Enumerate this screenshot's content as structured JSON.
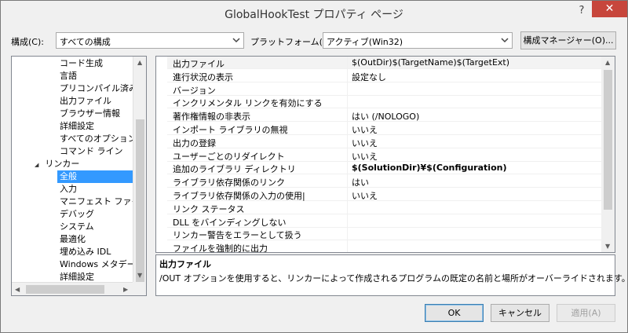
{
  "window": {
    "title": "GlobalHookTest プロパティ ページ",
    "help_glyph": "?",
    "close_glyph": "✕"
  },
  "toolbar": {
    "config_label": "構成(C):",
    "config_value": "すべての構成",
    "platform_label": "プラットフォーム(P):",
    "platform_value": "アクティブ(Win32)",
    "config_manager_button": "構成マネージャー(O)..."
  },
  "tree": {
    "items": [
      {
        "label": "コード生成",
        "level": 2
      },
      {
        "label": "言語",
        "level": 2
      },
      {
        "label": "プリコンパイル済みヘッ",
        "level": 2
      },
      {
        "label": "出力ファイル",
        "level": 2
      },
      {
        "label": "ブラウザー情報",
        "level": 2
      },
      {
        "label": "詳細設定",
        "level": 2
      },
      {
        "label": "すべてのオプション",
        "level": 2
      },
      {
        "label": "コマンド ライン",
        "level": 2
      },
      {
        "label": "リンカー",
        "level": 1,
        "expanded": true,
        "glyph": "◢"
      },
      {
        "label": "全般",
        "level": 2,
        "selected": true
      },
      {
        "label": "入力",
        "level": 2
      },
      {
        "label": "マニフェスト ファイル",
        "level": 2
      },
      {
        "label": "デバッグ",
        "level": 2
      },
      {
        "label": "システム",
        "level": 2
      },
      {
        "label": "最適化",
        "level": 2
      },
      {
        "label": "埋め込み IDL",
        "level": 2
      },
      {
        "label": "Windows メタデータ",
        "level": 2
      },
      {
        "label": "詳細設定",
        "level": 2
      }
    ]
  },
  "properties": {
    "rows": [
      {
        "name": "出力ファイル",
        "value": "$(OutDir)$(TargetName)$(TargetExt)",
        "selected": true
      },
      {
        "name": "進行状況の表示",
        "value": "設定なし"
      },
      {
        "name": "バージョン",
        "value": ""
      },
      {
        "name": "インクリメンタル リンクを有効にする",
        "value": ""
      },
      {
        "name": "著作権情報の非表示",
        "value": "はい (/NOLOGO)"
      },
      {
        "name": "インポート ライブラリの無視",
        "value": "いいえ"
      },
      {
        "name": "出力の登録",
        "value": "いいえ"
      },
      {
        "name": "ユーザーごとのリダイレクト",
        "value": "いいえ"
      },
      {
        "name": "追加のライブラリ ディレクトリ",
        "value": "$(SolutionDir)¥$(Configuration)",
        "bold": true
      },
      {
        "name": "ライブラリ依存関係のリンク",
        "value": "はい"
      },
      {
        "name": "ライブラリ依存関係の入力の使用|",
        "value": "いいえ"
      },
      {
        "name": "リンク ステータス",
        "value": ""
      },
      {
        "name": "DLL をバインディングしない",
        "value": ""
      },
      {
        "name": "リンカー警告をエラーとして扱う",
        "value": ""
      },
      {
        "name": "ファイルを強制的に出力",
        "value": ""
      }
    ]
  },
  "description": {
    "title": "出力ファイル",
    "text": "/OUT オプションを使用すると、リンカーによって作成されるプログラムの既定の名前と場所がオーバーライドされます。"
  },
  "buttons": {
    "ok": "OK",
    "cancel": "キャンセル",
    "apply": "適用(A)"
  }
}
